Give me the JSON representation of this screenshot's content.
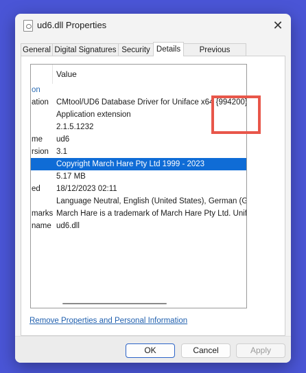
{
  "window": {
    "title": "ud6.dll Properties",
    "close_symbol": "✕"
  },
  "tabs": [
    "General",
    "Digital Signatures",
    "Security",
    "Details",
    "Previous Versions"
  ],
  "active_tab": "Details",
  "details": {
    "column_header": "Value",
    "rows": [
      {
        "prop": "on",
        "value": "",
        "group": true
      },
      {
        "prop": "ation",
        "value": "CMtool/UD6 Database Driver for Uniface x64 {994200}"
      },
      {
        "prop": "",
        "value": "Application extension"
      },
      {
        "prop": "",
        "value": "2.1.5.1232"
      },
      {
        "prop": "me",
        "value": "ud6"
      },
      {
        "prop": "rsion",
        "value": "3.1"
      },
      {
        "prop": "",
        "value": "Copyright   March Hare Pty Ltd 1999 - 2023",
        "selected": true
      },
      {
        "prop": "",
        "value": "5.17 MB"
      },
      {
        "prop": "ed",
        "value": "18/12/2023 02:11"
      },
      {
        "prop": "",
        "value": "Language Neutral, English (United States), German (Germa"
      },
      {
        "prop": "marks",
        "value": "March Hare is a trademark of March Hare Pty Ltd. Uniface"
      },
      {
        "prop": "name",
        "value": "ud6.dll"
      }
    ]
  },
  "link_text": "Remove Properties and Personal Information",
  "buttons": {
    "ok": "OK",
    "cancel": "Cancel",
    "apply": "Apply"
  }
}
